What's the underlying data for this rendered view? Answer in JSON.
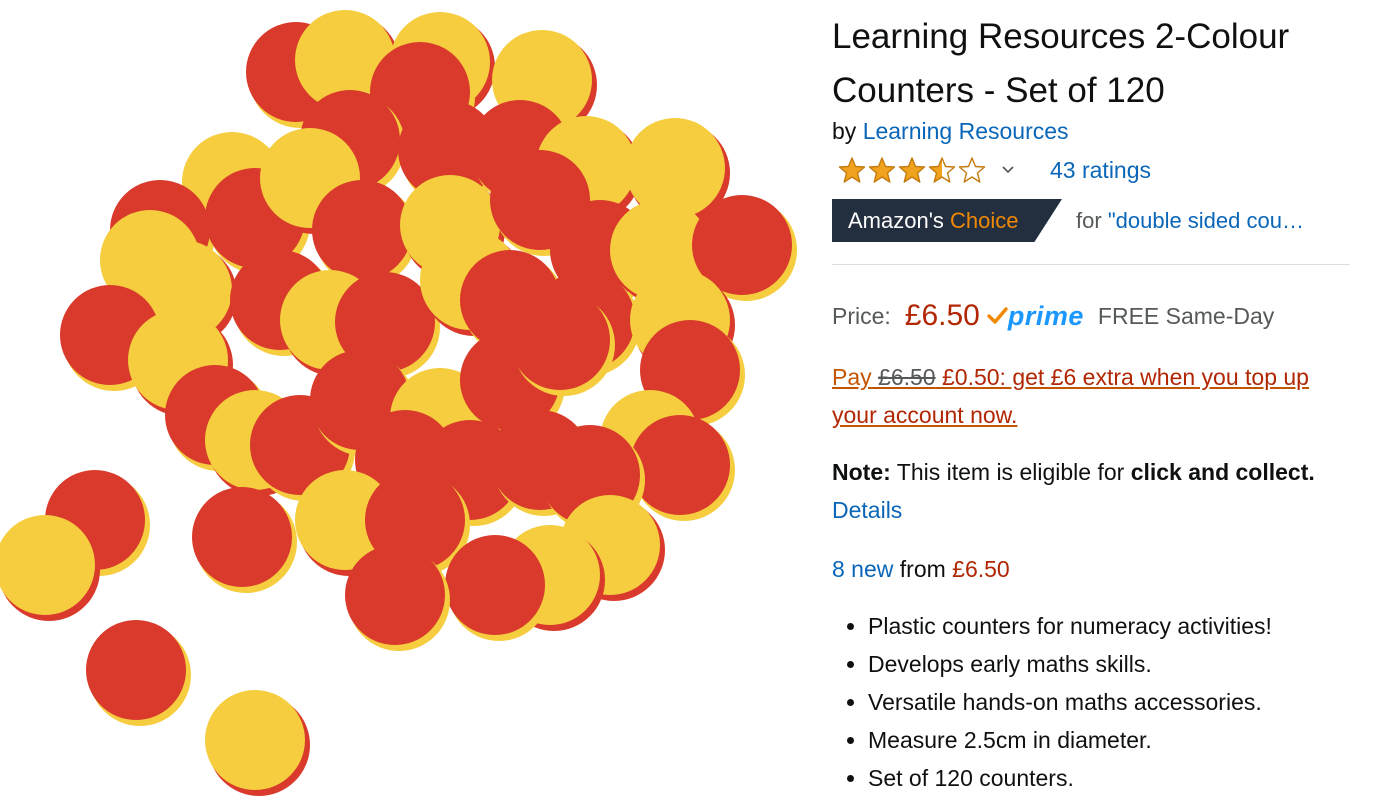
{
  "product": {
    "title": "Learning Resources 2-Colour Counters - Set of 120",
    "by_prefix": "by",
    "brand": "Learning Resources",
    "rating_stars": 3.5,
    "ratings_text": "43 ratings",
    "badge": {
      "first": "Amazon's",
      "second": "Choice"
    },
    "choice_for": {
      "prefix": "for",
      "query": "\"double sided cou…"
    },
    "price": {
      "label": "Price:",
      "value": "£6.50",
      "prime": "prime",
      "delivery": "FREE Same-Day"
    },
    "topup": {
      "pay": "Pay",
      "old": "£6.50",
      "rest": "£0.50: get £6 extra when you top up your account now."
    },
    "note": {
      "label": "Note:",
      "text": "This item is eligible for",
      "bold": "click and collect.",
      "details": "Details"
    },
    "offers": {
      "link": "8 new",
      "from": "from",
      "price": "£6.50"
    },
    "bullets": [
      "Plastic counters for numeracy activities!",
      "Develops early maths skills.",
      "Versatile hands-on maths accessories.",
      "Measure 2.5cm in diameter.",
      "Set of 120 counters."
    ]
  },
  "colors": {
    "red": "#d93a2b",
    "yellow": "#f5cd3f",
    "link": "#0a66b8",
    "price": "#b12704",
    "accent": "#f08804"
  },
  "icons": {
    "stars": "star-icon",
    "dropdown": "chevron-down-icon",
    "prime_check": "prime-check-icon"
  }
}
